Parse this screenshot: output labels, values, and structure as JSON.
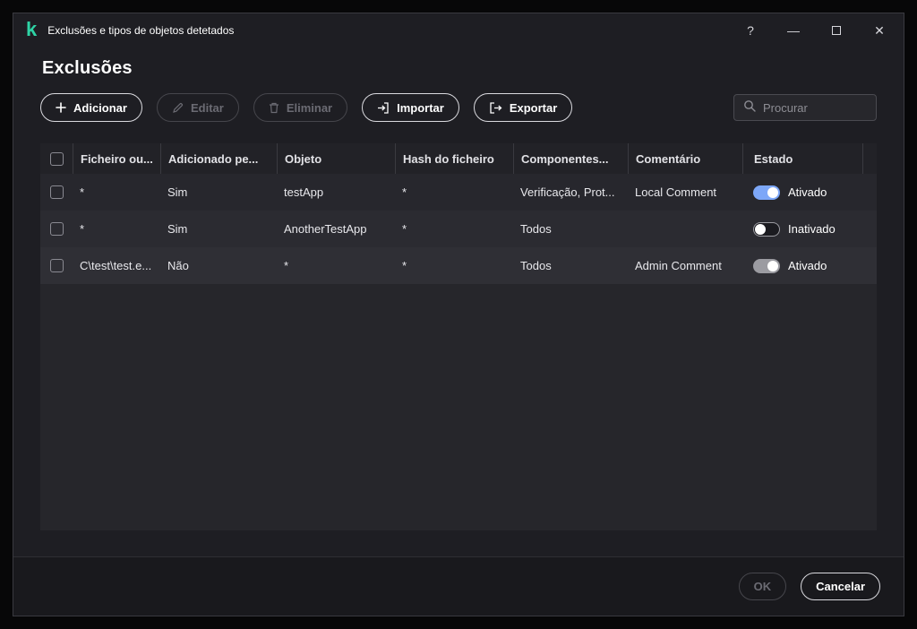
{
  "window": {
    "title": "Exclusões e tipos de objetos detetados",
    "controls": {
      "help": "?",
      "minimize": "—",
      "close": "✕"
    }
  },
  "page": {
    "title": "Exclusões"
  },
  "toolbar": {
    "add": "Adicionar",
    "edit": "Editar",
    "delete": "Eliminar",
    "import": "Importar",
    "export": "Exportar"
  },
  "search": {
    "placeholder": "Procurar"
  },
  "table": {
    "columns": [
      "Ficheiro ou...",
      "Adicionado pe...",
      "Objeto",
      "Hash do ficheiro",
      "Componentes...",
      "Comentário",
      "Estado"
    ],
    "rows": [
      {
        "file": "*",
        "added": "Sim",
        "object": "testApp",
        "hash": "*",
        "components": "Verificação, Prot...",
        "comment": "Local Comment",
        "state": "Ativado",
        "toggle": "on"
      },
      {
        "file": "*",
        "added": "Sim",
        "object": "AnotherTestApp",
        "hash": "*",
        "components": "Todos",
        "comment": "",
        "state": "Inativado",
        "toggle": "off"
      },
      {
        "file": "C\\test\\test.e...",
        "added": "Não",
        "object": "*",
        "hash": "*",
        "components": "Todos",
        "comment": "Admin Comment",
        "state": "Ativado",
        "toggle": "disabled-on"
      }
    ]
  },
  "footer": {
    "ok": "OK",
    "cancel": "Cancelar"
  },
  "colors": {
    "brand_green": "#2ed3a5",
    "toggle_on": "#7da7f8",
    "toggle_disabled": "#9b9ba1"
  }
}
